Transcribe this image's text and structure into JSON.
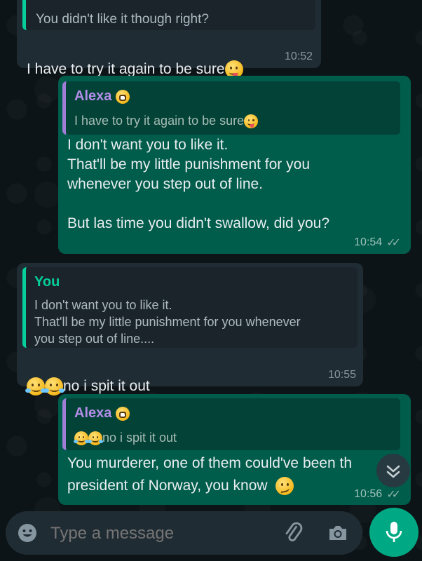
{
  "messages": [
    {
      "direction": "in",
      "quote": {
        "text": "You didn't like it though right?"
      },
      "text": "I have to try it again to be sure",
      "time": "10:52"
    },
    {
      "direction": "out",
      "quote": {
        "author": "Alexa",
        "text": "I have to try it again to be sure"
      },
      "text": "I don't want you to like it.\nThat'll be my little punishment for you\nwhenever you step out of line.\n\nBut las time you didn't swallow, did you?",
      "time": "10:54"
    },
    {
      "direction": "in",
      "quote": {
        "author": "You",
        "text": "I don't want you to like it.\nThat'll be my little punishment for you whenever\nyou step out of line...."
      },
      "text": "no i spit it out",
      "time": "10:55"
    },
    {
      "direction": "out",
      "quote": {
        "author": "Alexa",
        "text": "no i spit it out"
      },
      "text_line1": "You murderer, one of them could've been th",
      "text_line2": "president of Norway, you know",
      "time": "10:56"
    }
  ],
  "composer": {
    "placeholder": "Type a message"
  },
  "icons": {
    "emoji": "emoji-icon",
    "attach": "paperclip-icon",
    "camera": "camera-icon",
    "mic": "microphone-icon",
    "scroll": "chevrons-down-icon"
  },
  "colors": {
    "incoming_bubble": "#202c33",
    "outgoing_bubble": "#005c4b",
    "accent": "#00a884",
    "quote_author_out": "#b38ee8",
    "quote_author_in": "#06cf9c"
  }
}
